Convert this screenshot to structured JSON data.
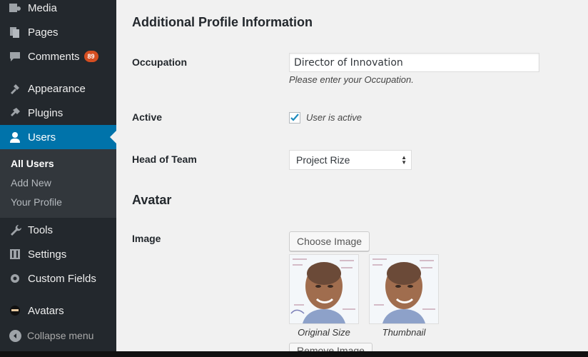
{
  "sidebar": {
    "items": [
      {
        "label": "Media",
        "icon": "media-icon"
      },
      {
        "label": "Pages",
        "icon": "pages-icon"
      },
      {
        "label": "Comments",
        "icon": "comments-icon",
        "badge": "89"
      },
      {
        "label": "Appearance",
        "icon": "appearance-icon"
      },
      {
        "label": "Plugins",
        "icon": "plugins-icon"
      },
      {
        "label": "Users",
        "icon": "users-icon"
      },
      {
        "label": "Tools",
        "icon": "tools-icon"
      },
      {
        "label": "Settings",
        "icon": "settings-icon"
      },
      {
        "label": "Custom Fields",
        "icon": "gear-icon"
      },
      {
        "label": "Avatars",
        "icon": "avatar-ninja-icon"
      }
    ],
    "submenu": [
      "All Users",
      "Add New",
      "Your Profile"
    ],
    "collapse_label": "Collapse menu"
  },
  "main": {
    "section_title": "Additional Profile Information",
    "occupation_label": "Occupation",
    "occupation_value": "Director of Innovation",
    "occupation_help": "Please enter your Occupation.",
    "active_label": "Active",
    "active_checkbox_label": "User is active",
    "head_label": "Head of Team",
    "head_selected": "Project Rize",
    "avatar_title": "Avatar",
    "image_label": "Image",
    "choose_button": "Choose Image",
    "original_caption": "Original Size",
    "thumbnail_caption": "Thumbnail",
    "remove_button": "Remove Image"
  },
  "colors": {
    "accent": "#0073aa",
    "badge": "#d54e21",
    "sidebar": "#23282d",
    "content_bg": "#f1f1f1"
  }
}
